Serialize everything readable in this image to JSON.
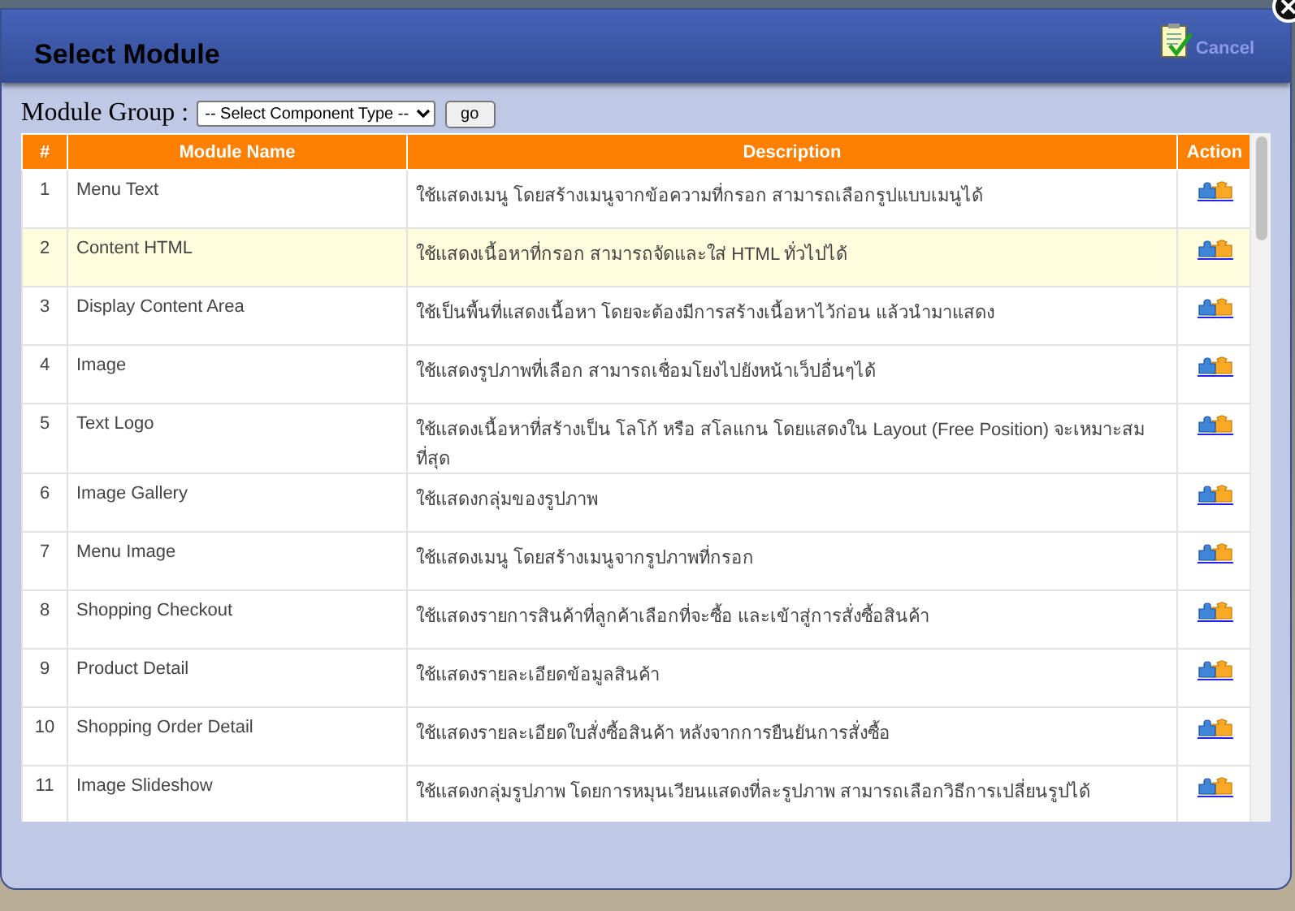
{
  "dialog": {
    "title": "Select Module",
    "cancel_label": "Cancel"
  },
  "filter": {
    "label": "Module Group :",
    "select_value": "-- Select Component Type --",
    "button": "go"
  },
  "table": {
    "columns": [
      "#",
      "Module Name",
      "Description",
      "Action"
    ],
    "rows": [
      {
        "num": "1",
        "name": "Menu Text",
        "description": "ใช้แสดงเมนู โดยสร้างเมนูจากข้อความที่กรอก สามารถเลือกรูปแบบเมนูได้",
        "selected": false
      },
      {
        "num": "2",
        "name": "Content HTML",
        "description": "ใช้แสดงเนื้อหาที่กรอก สามารถจัดและใส่ HTML ทั่วไปได้",
        "selected": true
      },
      {
        "num": "3",
        "name": "Display Content Area",
        "description": "ใช้เป็นพื้นที่แสดงเนื้อหา โดยจะต้องมีการสร้างเนื้อหาไว้ก่อน แล้วนำมาแสดง",
        "selected": false
      },
      {
        "num": "4",
        "name": "Image",
        "description": "ใช้แสดงรูปภาพที่เลือก สามารถเชื่อมโยงไปยังหน้าเว็ปอื่นๆได้",
        "selected": false
      },
      {
        "num": "5",
        "name": "Text Logo",
        "description": "ใช้แสดงเนื้อหาที่สร้างเป็น โลโก้ หรือ สโลแกน โดยแสดงใน Layout (Free Position) จะเหมาะสมที่สุด",
        "selected": false
      },
      {
        "num": "6",
        "name": "Image Gallery",
        "description": "ใช้แสดงกลุ่มของรูปภาพ",
        "selected": false
      },
      {
        "num": "7",
        "name": "Menu Image",
        "description": "ใช้แสดงเมนู โดยสร้างเมนูจากรูปภาพที่กรอก",
        "selected": false
      },
      {
        "num": "8",
        "name": "Shopping Checkout",
        "description": "ใช้แสดงรายการสินค้าที่ลูกค้าเลือกที่จะซื้อ และเข้าสู่การสั่งซื้อสินค้า",
        "selected": false
      },
      {
        "num": "9",
        "name": "Product Detail",
        "description": "ใช้แสดงรายละเอียดข้อมูลสินค้า",
        "selected": false
      },
      {
        "num": "10",
        "name": "Shopping Order Detail",
        "description": "ใช้แสดงรายละเอียดใบสั่งซื้อสินค้า หลังจากการยืนยันการสั่งซื้อ",
        "selected": false
      },
      {
        "num": "11",
        "name": "Image Slideshow",
        "description": "ใช้แสดงกลุ่มรูปภาพ โดยการหมุนเวียนแสดงที่ละรูปภาพ สามารถเลือกวิธีการเปลี่ยนรูปได้",
        "selected": false
      }
    ]
  }
}
